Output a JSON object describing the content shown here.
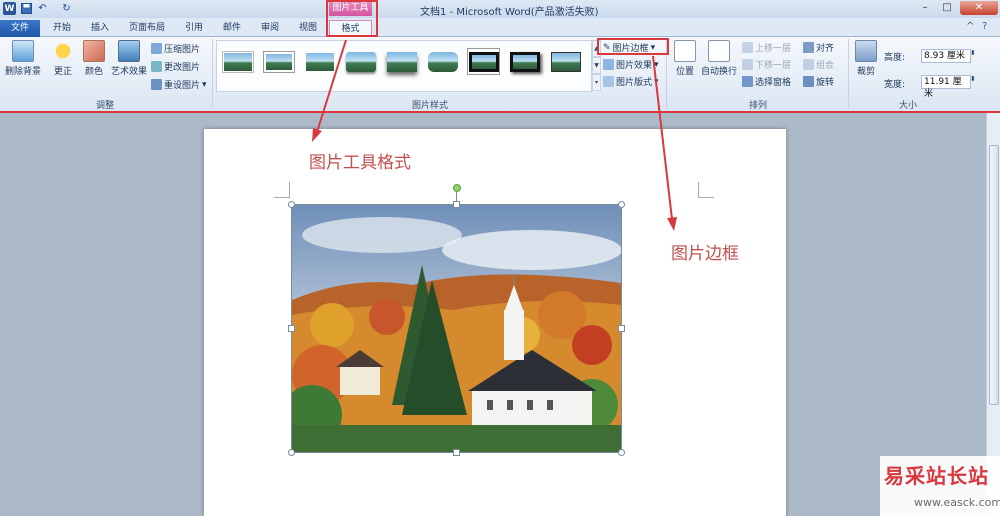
{
  "window": {
    "title": "文档1 - Microsoft Word(产品激活失败)",
    "context_tab_header": "图片工具",
    "controls": {
      "minimize": "–",
      "maximize": "□",
      "close": "✕"
    }
  },
  "quick_access": {
    "word_icon": "W",
    "undo": "↶",
    "redo": "↻"
  },
  "tabs": [
    {
      "label": "文件"
    },
    {
      "label": "开始"
    },
    {
      "label": "插入"
    },
    {
      "label": "页面布局"
    },
    {
      "label": "引用"
    },
    {
      "label": "邮件"
    },
    {
      "label": "审阅"
    },
    {
      "label": "视图"
    },
    {
      "label": "格式"
    }
  ],
  "ribbon": {
    "adjust_group": {
      "label": "调整",
      "remove_bg": "删除背景",
      "correct": "更正",
      "color": "颜色",
      "art_effects": "艺术效果",
      "compress": "压缩图片",
      "change": "更改图片",
      "reset": "重设图片"
    },
    "styles_group": {
      "label": "图片样式",
      "border": "图片边框",
      "effects": "图片效果",
      "layout": "图片版式"
    },
    "arrange_group": {
      "label": "排列",
      "position": "位置",
      "wrap": "自动换行",
      "forward": "上移一层",
      "backward": "下移一层",
      "selection_pane": "选择窗格",
      "align": "对齐",
      "group": "组合",
      "rotate": "旋转"
    },
    "size_group": {
      "label": "大小",
      "crop": "裁剪",
      "height_label": "高度:",
      "height_value": "8.93 厘米",
      "width_label": "宽度:",
      "width_value": "11.91 厘米"
    }
  },
  "annotations": {
    "format_tab": "图片工具格式",
    "picture_border": "图片边框"
  },
  "watermark": {
    "title": "易采站长站",
    "url": "www.easck.com"
  },
  "colors": {
    "annotation_red": "#d9383d",
    "file_tab_blue": "#1e58a8",
    "context_pink": "#d254a0"
  }
}
